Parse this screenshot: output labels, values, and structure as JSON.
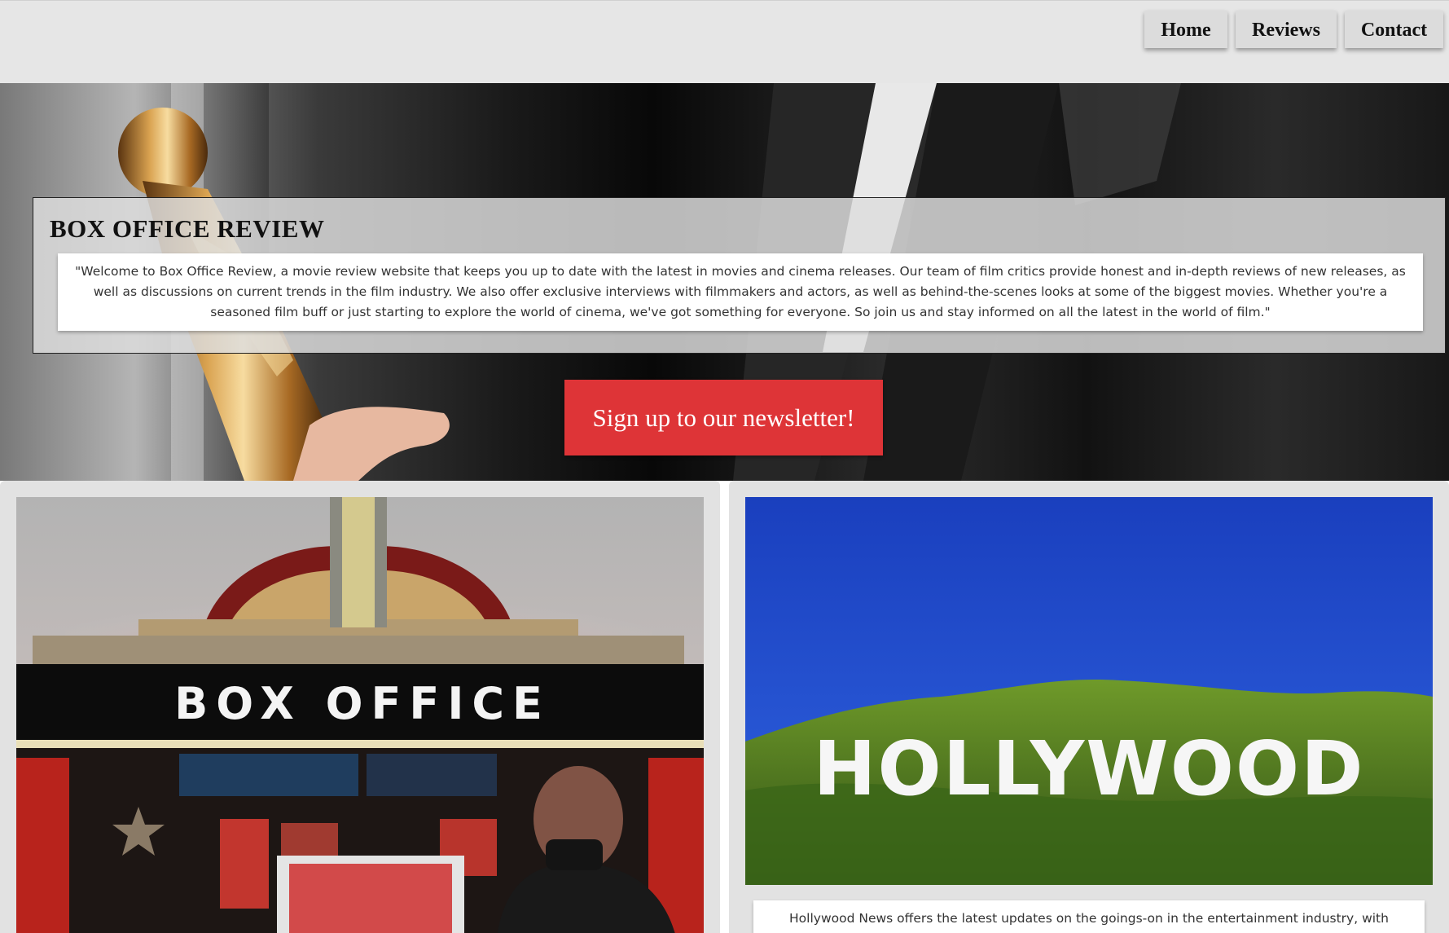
{
  "nav": {
    "home_label": "Home",
    "reviews_label": "Reviews",
    "contact_label": "Contact"
  },
  "hero": {
    "title": "BOX OFFICE REVIEW",
    "intro": "\"Welcome to Box Office Review, a movie review website that keeps you up to date with the latest in movies and cinema releases. Our team of film critics provide honest and in-depth reviews of new releases, as well as discussions on current trends in the film industry. We also offer exclusive interviews with filmmakers and actors, as well as behind-the-scenes looks at some of the biggest movies. Whether you're a seasoned film buff or just starting to explore the world of cinema, we've got something for everyone. So join us and stay informed on all the latest in the world of film.\"",
    "cta_label": "Sign up to our newsletter!"
  },
  "cards": {
    "box_office": {
      "sign_text": "BOX OFFICE"
    },
    "hollywood": {
      "sign_text": "HOLLYWOOD",
      "description": "Hollywood News offers the latest updates on the goings-on in the entertainment industry, with"
    }
  },
  "colors": {
    "accent": "#de3437",
    "header_bg": "#e6e6e6",
    "card_bg": "#e2e2e2",
    "sky": "#1b45c8",
    "hills": "#4f7f1c"
  },
  "icons": {
    "star": "star-icon"
  }
}
